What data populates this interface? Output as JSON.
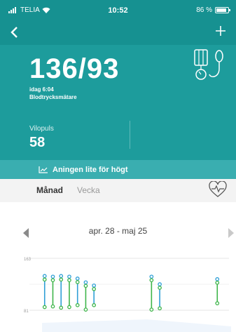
{
  "status_bar": {
    "carrier": "TELIA",
    "time": "10:52",
    "battery": "86 %",
    "battery_level": 0.86
  },
  "nav": {
    "back_icon": "chevron-left-icon",
    "add_icon": "plus-icon"
  },
  "reading": {
    "value": "136/93",
    "time": "idag 6:04",
    "source": "Blodtrycksmätare",
    "icon": "blood-pressure-monitor-icon"
  },
  "pulse": {
    "label": "Vilopuls",
    "value": "58"
  },
  "status": {
    "text": "Aningen lite för högt",
    "icon": "trend-icon"
  },
  "tabs": {
    "month": "Månad",
    "week": "Vecka",
    "heart_icon": "heart-rate-icon"
  },
  "range": {
    "label": "apr. 28 - maj 25"
  },
  "colors": {
    "header": "#1d9c9c",
    "systolic": "#2f9fd6",
    "diastolic": "#3eb54a"
  },
  "chart_data": {
    "type": "scatter",
    "ylim": [
      81,
      163
    ],
    "ytick_labels": [
      "163",
      "81"
    ],
    "series": [
      {
        "values": [
          {
            "x": 1,
            "systolic": 135,
            "diastolic": 86
          },
          {
            "x": 2,
            "systolic": 134,
            "diastolic": 87
          },
          {
            "x": 3,
            "systolic": 135,
            "diastolic": 85
          },
          {
            "x": 4,
            "systolic": 134,
            "diastolic": 86
          },
          {
            "x": 5,
            "systolic": 131,
            "diastolic": 89
          },
          {
            "x": 6,
            "systolic": 125,
            "diastolic": 82
          },
          {
            "x": 7,
            "systolic": 120,
            "diastolic": 89
          },
          {
            "x": 14,
            "systolic": 134,
            "diastolic": 82
          },
          {
            "x": 15,
            "systolic": 122,
            "diastolic": 84
          },
          {
            "x": 22,
            "systolic": 130,
            "diastolic": 92
          }
        ]
      }
    ]
  }
}
